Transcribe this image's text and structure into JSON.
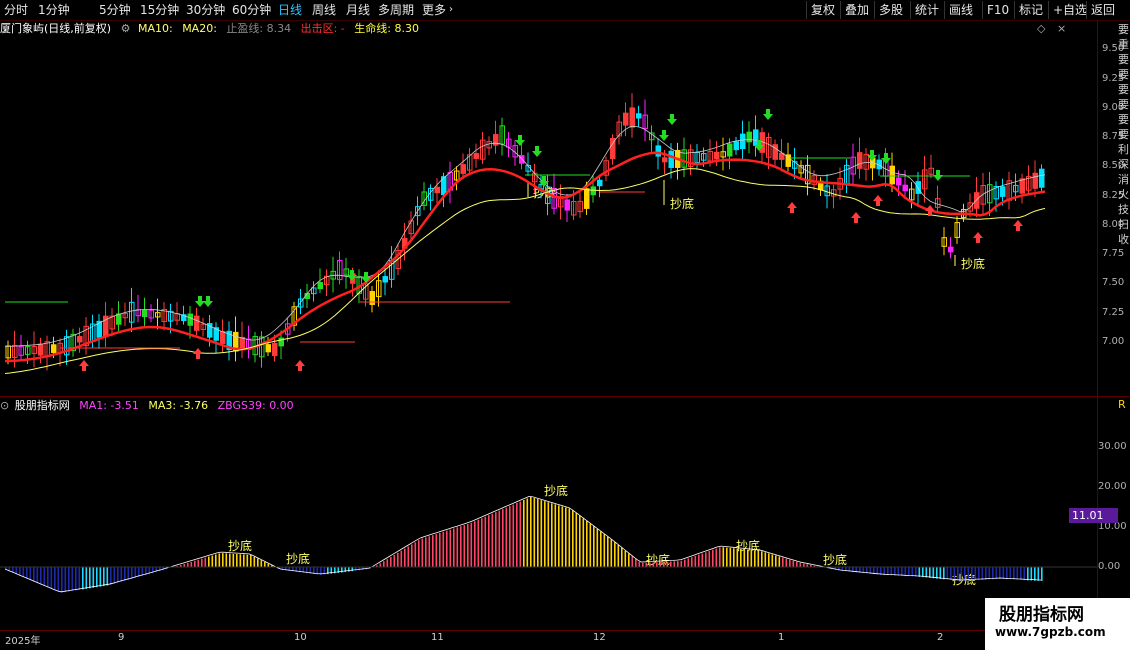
{
  "toolbar": {
    "periods": [
      "分时",
      "1分钟",
      "5分钟",
      "15分钟",
      "30分钟",
      "60分钟",
      "日线",
      "周线",
      "月线",
      "多周期",
      "更多"
    ],
    "active_period": "日线",
    "right_buttons": [
      "复权",
      "叠加",
      "多股",
      "统计",
      "画线",
      "F10",
      "标记",
      "+自选",
      "返回"
    ]
  },
  "main_info": {
    "stock": "厦门象屿(日线,前复权)",
    "ma10": "MA10:",
    "ma20": "MA20:",
    "stop_profit": "止盈线: 8.34",
    "exit_zone": "出击区: -",
    "life_line": "生命线: 8.30"
  },
  "sub_info": {
    "name": "股朋指标网",
    "ma1": "MA1: -3.51",
    "ma3": "MA3: -3.76",
    "zbgs": "ZBGS39: 0.00"
  },
  "main_axis": [
    "9.50",
    "9.25",
    "9.00",
    "8.75",
    "8.50",
    "8.25",
    "8.00",
    "7.75",
    "7.50",
    "7.25",
    "7.00"
  ],
  "sub_axis": [
    "30.00",
    "20.00",
    "10.00",
    "0.00"
  ],
  "sub_current_value": "11.01",
  "x_axis": [
    "2025年",
    "9",
    "10",
    "11",
    "12",
    "1",
    "2"
  ],
  "labels": {
    "chaodi": "抄底"
  },
  "right_strip": "要 重 要 要 要 要 要 要 利 深 消 火 技 扫 收",
  "watermark": {
    "title": "股朋指标网",
    "url": "www.7gpzb.com"
  },
  "colors": {
    "up": "#ff3b3b",
    "down": "#00e0ff",
    "buy": "#ffd400",
    "sell": "#22dd22",
    "weak": "#ff22ff",
    "ma_red": "#ff2020",
    "ma_yellow": "#ffff66",
    "ma_white": "#cccccc"
  }
}
